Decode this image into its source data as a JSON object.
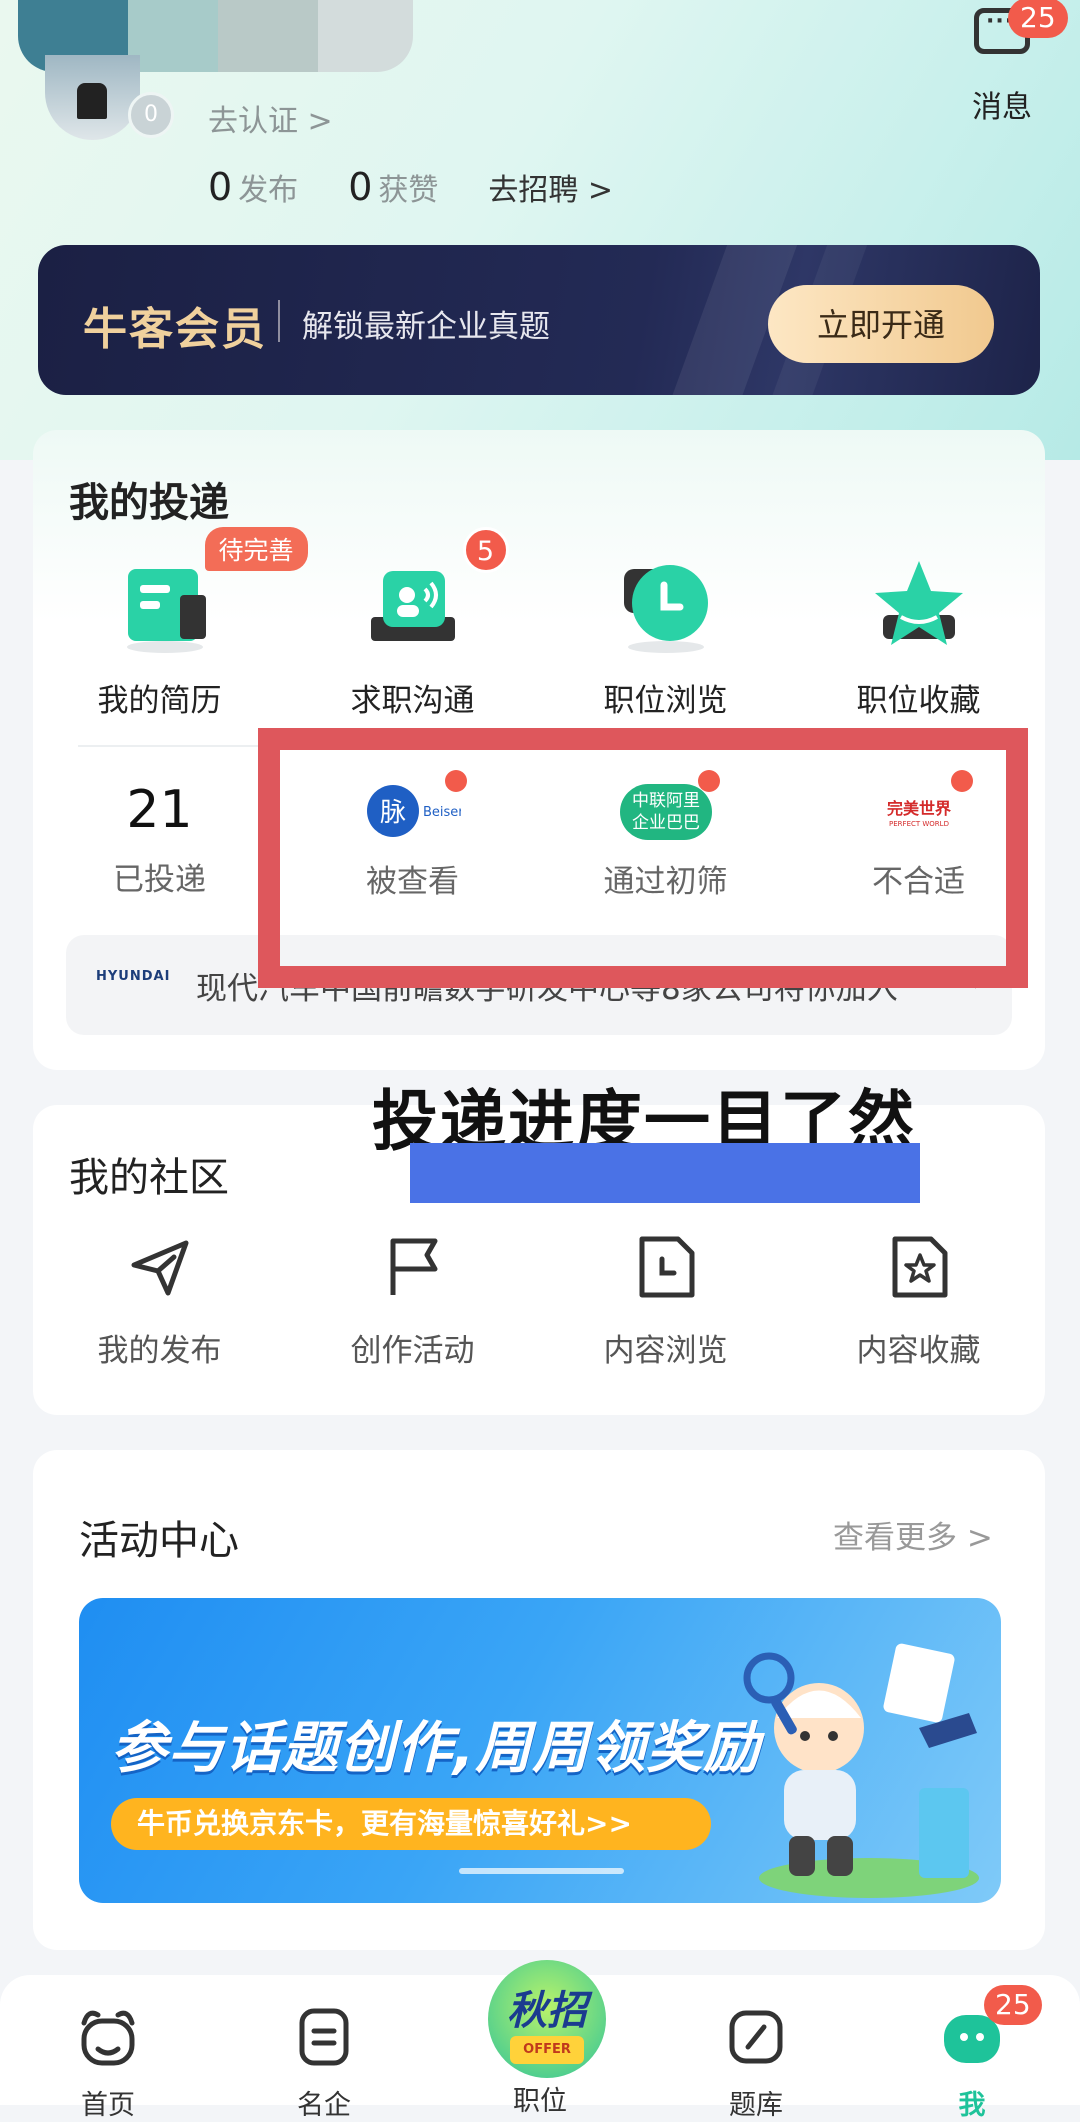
{
  "header": {
    "verify_label": "去认证 >",
    "avatar_badge": "0",
    "posts_count": "0",
    "posts_label": "发布",
    "likes_count": "0",
    "likes_label": "获赞",
    "recruit_label": "去招聘 >",
    "message_label": "消息",
    "message_badge": "25"
  },
  "vip": {
    "title": "牛客会员",
    "subtitle": "解锁最新企业真题",
    "button": "立即开通"
  },
  "delivery": {
    "title": "我的投递",
    "items": [
      {
        "label": "我的简历",
        "tag": "待完善",
        "icon": "resume-icon"
      },
      {
        "label": "求职沟通",
        "badge": "5",
        "icon": "chat-icon"
      },
      {
        "label": "职位浏览",
        "icon": "clock-icon"
      },
      {
        "label": "职位收藏",
        "icon": "star-icon"
      }
    ],
    "status": [
      {
        "count": "21",
        "label": "已投递"
      },
      {
        "label": "被查看",
        "logo_text": "脉 Beisen"
      },
      {
        "label": "通过初筛",
        "logo_text": "中联阿里 企业巴巴"
      },
      {
        "label": "不合适",
        "logo_text": "完美世界"
      }
    ],
    "notice_logo": "HYUNDAI",
    "notice_text": "现代汽车中国前瞻数字研发中心等8家公司将你加入"
  },
  "overlay": {
    "caption": "投递进度一目了然"
  },
  "community": {
    "title": "我的社区",
    "items": [
      {
        "label": "我的发布",
        "icon": "send-icon"
      },
      {
        "label": "创作活动",
        "icon": "flag-icon"
      },
      {
        "label": "内容浏览",
        "icon": "document-clock-icon"
      },
      {
        "label": "内容收藏",
        "icon": "document-star-icon"
      }
    ]
  },
  "activity": {
    "title": "活动中心",
    "more": "查看更多 >",
    "banner_main": "参与话题创作,周周领奖励",
    "banner_sub": "牛币兑换京东卡，更有海量惊喜好礼>>"
  },
  "tabbar": {
    "items": [
      {
        "label": "首页",
        "icon": "cow-icon"
      },
      {
        "label": "名企",
        "icon": "list-icon"
      },
      {
        "label": "职位",
        "icon": "autumn-recruit-icon",
        "center_text": "秋招",
        "ribbon": "OFFER"
      },
      {
        "label": "题库",
        "icon": "pencil-icon"
      },
      {
        "label": "我",
        "icon": "me-icon",
        "badge": "25"
      }
    ]
  },
  "colors": {
    "accent": "#1ec39a",
    "badge": "#f25b4b",
    "highlight_box": "#de575c",
    "vip_gold": "#f0d19d"
  }
}
